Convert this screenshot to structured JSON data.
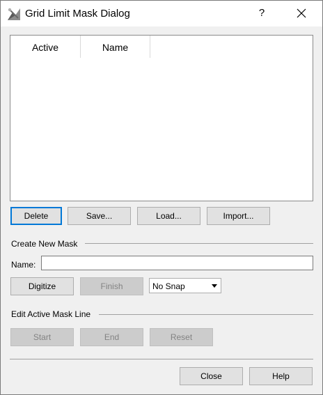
{
  "window": {
    "title": "Grid Limit Mask Dialog",
    "help_glyph": "?"
  },
  "mask_list": {
    "columns": [
      "Active",
      "Name"
    ]
  },
  "list_buttons": {
    "delete": "Delete",
    "save": "Save...",
    "load": "Load...",
    "import": "Import..."
  },
  "create_group": {
    "label": "Create New Mask",
    "name_label": "Name:",
    "name_value": "",
    "digitize": "Digitize",
    "finish": "Finish",
    "snap_selected": "No Snap"
  },
  "edit_group": {
    "label": "Edit Active Mask Line",
    "start": "Start",
    "end": "End",
    "reset": "Reset"
  },
  "footer": {
    "close": "Close",
    "help": "Help"
  },
  "colors": {
    "focus": "#0078d7",
    "disabled_text": "#838383",
    "face": "#e1e1e1"
  }
}
